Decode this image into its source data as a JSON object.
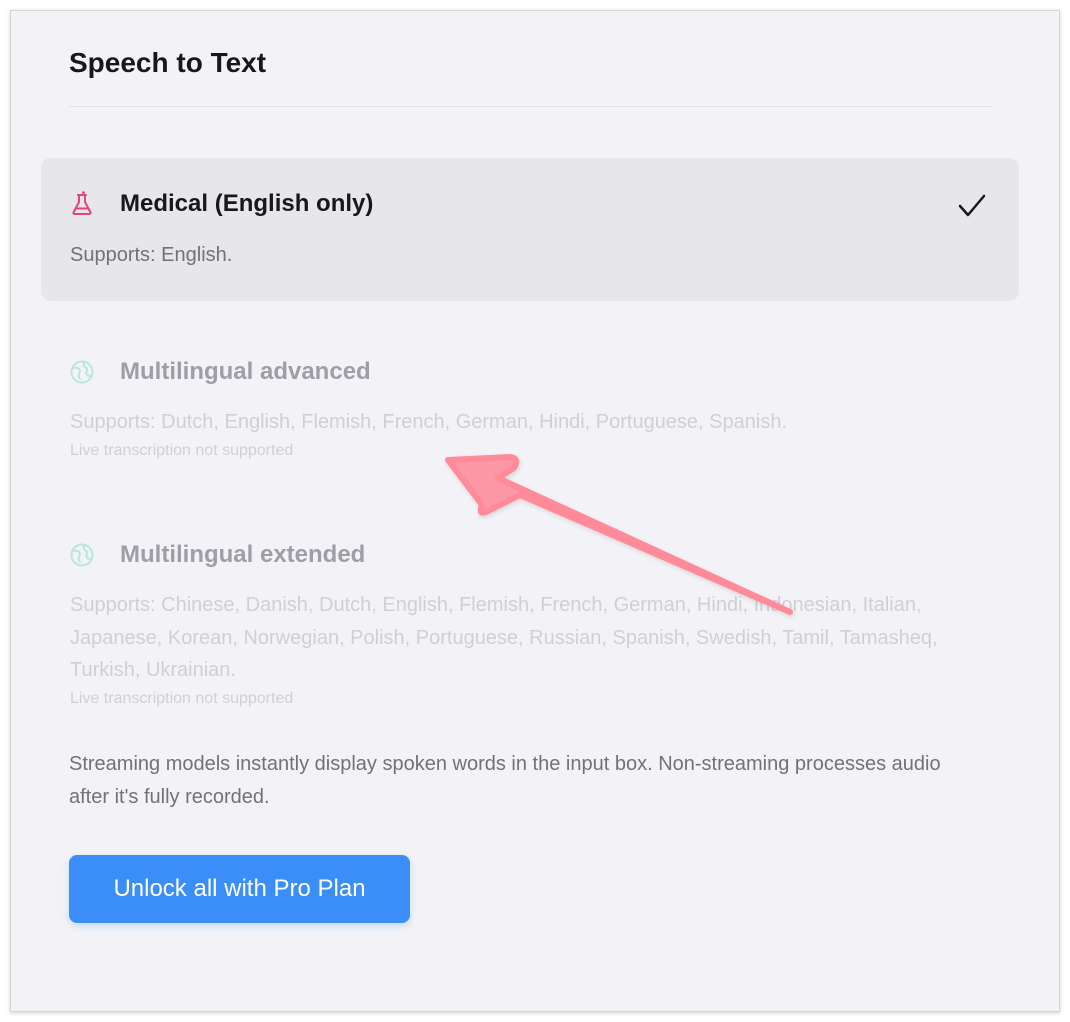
{
  "panel": {
    "title": "Speech to Text"
  },
  "options": [
    {
      "name": "Medical (English only)",
      "supports": "Supports: English.",
      "icon": "flask-icon",
      "icon_color": "#e0457b",
      "selected": true
    },
    {
      "name": "Multilingual advanced",
      "supports": "Supports: Dutch, English, Flemish, French, German, Hindi, Portuguese, Spanish.",
      "note": "Live transcription not supported",
      "icon": "globe-icon",
      "icon_color": "#b9e6dd",
      "selected": false
    },
    {
      "name": "Multilingual extended",
      "supports": "Supports: Chinese, Danish, Dutch, English, Flemish, French, German, Hindi, Indonesian, Italian, Japanese, Korean, Norwegian, Polish, Portuguese, Russian, Spanish, Swedish, Tamil, Tamasheq, Turkish, Ukrainian.",
      "note": "Live transcription not supported",
      "icon": "globe-icon",
      "icon_color": "#b9e6dd",
      "selected": false
    }
  ],
  "info_text": "Streaming models instantly display spoken words in the input box. Non-streaming processes audio after it's fully recorded.",
  "cta": {
    "label": "Unlock all with Pro Plan"
  },
  "colors": {
    "accent": "#3b8ef7",
    "annotation_arrow": "#ff8a9a",
    "selected_bg": "#e6e6eb"
  }
}
